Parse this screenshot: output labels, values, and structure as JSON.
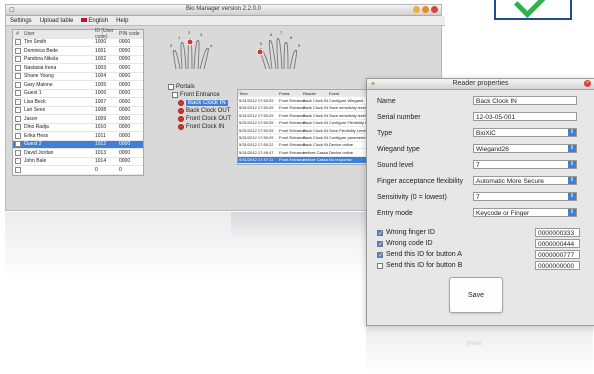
{
  "app": {
    "title": "Bio Manager version 2.2.0.0",
    "menu": [
      "Settings",
      "Upload table",
      "English",
      "Help"
    ]
  },
  "users": {
    "columns": [
      "#",
      "User",
      "ID (User code)",
      "PIN code"
    ],
    "rows": [
      {
        "name": "Tim Smith",
        "id": "1000",
        "pin": "0000"
      },
      {
        "name": "Dominica Bede",
        "id": "1001",
        "pin": "0000"
      },
      {
        "name": "Pandora Nikola",
        "id": "1002",
        "pin": "0000"
      },
      {
        "name": "Nastasia Irena",
        "id": "1003",
        "pin": "0000"
      },
      {
        "name": "Shane Young",
        "id": "1004",
        "pin": "0000"
      },
      {
        "name": "Gary Malone",
        "id": "1005",
        "pin": "0000"
      },
      {
        "name": "Guest 1",
        "id": "1006",
        "pin": "0000"
      },
      {
        "name": "Lisa Beck",
        "id": "1007",
        "pin": "0000"
      },
      {
        "name": "Lari Sees",
        "id": "1008",
        "pin": "0000"
      },
      {
        "name": "Jason",
        "id": "1009",
        "pin": "0000"
      },
      {
        "name": "Dino Radja",
        "id": "1010",
        "pin": "0000"
      },
      {
        "name": "Erika Hess",
        "id": "1011",
        "pin": "0000"
      },
      {
        "name": "Guest 2",
        "id": "1012",
        "pin": "0000"
      },
      {
        "name": "David Jordan",
        "id": "1013",
        "pin": "0000"
      },
      {
        "name": "John Bale",
        "id": "1014",
        "pin": "0000"
      },
      {
        "name": "",
        "id": "0",
        "pin": "0"
      }
    ]
  },
  "hand_labels": [
    "0",
    "1",
    "2",
    "3",
    "4",
    "5",
    "6",
    "7",
    "8",
    "9"
  ],
  "tree": {
    "root": "Portals",
    "group": "Front Entrance",
    "items": [
      "Back Clock IN",
      "Back Clock OUT",
      "Front Clock OUT",
      "Front Clock IN"
    ]
  },
  "log": {
    "columns": [
      "Time",
      "Portal",
      "Reader",
      "Event"
    ],
    "rows": [
      {
        "time": "5/31/2012 17:50:29",
        "portal": "Front Entrance",
        "reader": "Back Clock IN",
        "event": "Configure Wiegand"
      },
      {
        "time": "5/31/2012 17:50:29",
        "portal": "Front Entrance",
        "reader": "Back Clock IN",
        "event": "Save sensitivity level"
      },
      {
        "time": "5/31/2012 17:50:29",
        "portal": "Front Entrance",
        "reader": "Back Clock IN",
        "event": "Save sensitivity level"
      },
      {
        "time": "5/31/2012 17:50:29",
        "portal": "Front Entrance",
        "reader": "Back Clock IN",
        "event": "Configure Flexibility Level"
      },
      {
        "time": "5/31/2012 17:50:29",
        "portal": "Front Entrance",
        "reader": "Back Clock IN",
        "event": "Save Flexibility Level"
      },
      {
        "time": "5/31/2012 17:50:29",
        "portal": "Front Entrance",
        "reader": "Back Clock IN",
        "event": "Configure parameters"
      },
      {
        "time": "5/31/2012 17:50:22",
        "portal": "Front Entrance",
        "reader": "Back Clock IN",
        "event": "Device online"
      },
      {
        "time": "5/31/2012 17:49:47",
        "portal": "Front Entrance",
        "reader": "Lettore Cassa",
        "event": "Device online"
      },
      {
        "time": "5/31/2012 17:47:11",
        "portal": "Front Entrance",
        "reader": "Lettore Cassa",
        "event": "No response"
      }
    ]
  },
  "dialog": {
    "title": "Reader properties",
    "fields": {
      "name": {
        "label": "Name",
        "value": "Back Clock IN"
      },
      "serial": {
        "label": "Serial number",
        "value": "12-03-05-001"
      },
      "type": {
        "label": "Type",
        "value": "BioXiC"
      },
      "wiegand": {
        "label": "Wiegand type",
        "value": "Wiegand26"
      },
      "sound": {
        "label": "Sound level",
        "value": "7"
      },
      "flex": {
        "label": "Finger acceptance flexibility",
        "value": "Automatic More Secure"
      },
      "sensitivity": {
        "label": "Sensitivity (0 = lowest)",
        "value": "7"
      },
      "entry": {
        "label": "Entry mode",
        "value": "Keycode or Finger"
      }
    },
    "checks": [
      {
        "label": "Wrong finger ID",
        "value": "0000000333",
        "checked": true
      },
      {
        "label": "Wrong code ID",
        "value": "0000000444",
        "checked": true
      },
      {
        "label": "Send this ID for button A",
        "value": "0000000777",
        "checked": true
      },
      {
        "label": "Send this ID for button B",
        "value": "0000000000",
        "checked": false
      }
    ],
    "save_label": "Save"
  }
}
